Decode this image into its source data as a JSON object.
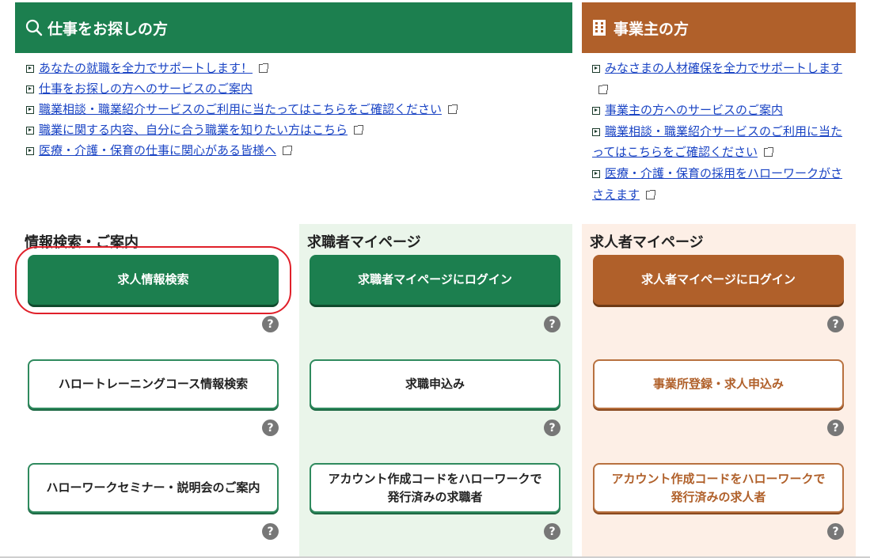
{
  "header": {
    "seeker_title": "仕事をお探しの方",
    "employer_title": "事業主の方",
    "seeker_color": "#1c7f4f",
    "employer_color": "#b0602a"
  },
  "seeker_links": [
    "あなたの就職を全力でサポートします！",
    "仕事をお探しの方へのサービスのご案内",
    "職業相談・職業紹介サービスのご利用に当たってはこちらをご確認ください",
    "職業に関する内容、自分に合う職業を知りたい方はこちら",
    "医療・介護・保育の仕事に関心がある皆様へ"
  ],
  "employer_links": [
    "みなさまの人材確保を全力でサポートします",
    "事業主の方へのサービスのご案内",
    "職業相談・職業紹介サービスのご利用に当たってはこちらをご確認ください",
    "医療・介護・保育の採用をハローワークがささえます"
  ],
  "columns": {
    "info": {
      "title": "情報検索・ご案内",
      "buttons": [
        "求人情報検索",
        "ハロートレーニングコース情報検索",
        "ハローワークセミナー・説明会のご案内"
      ]
    },
    "seeker_mypage": {
      "title": "求職者マイページ",
      "buttons": [
        "求職者マイページにログイン",
        "求職申込み",
        "アカウント作成コードをハローワークで",
        "発行済みの求職者"
      ]
    },
    "employer_mypage": {
      "title": "求人者マイページ",
      "buttons": [
        "求人者マイページにログイン",
        "事業所登録・求人申込み",
        "アカウント作成コードをハローワークで",
        "発行済みの求人者"
      ]
    }
  },
  "help_label": "?"
}
